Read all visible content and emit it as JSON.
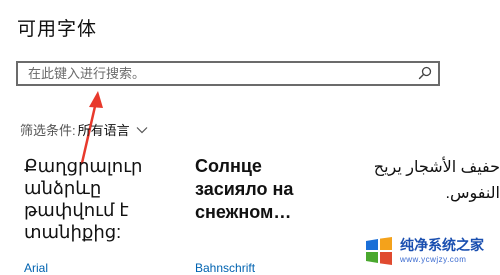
{
  "page": {
    "title": "可用字体"
  },
  "search": {
    "placeholder": "在此键入进行搜索。",
    "value": "",
    "icon": "search-icon"
  },
  "filter": {
    "label": "筛选条件:",
    "value": "所有语言",
    "icon": "chevron-down-icon"
  },
  "fonts": [
    {
      "sample": "Քաղցրալուր անձրևը թափվում է տանիքից:",
      "name": "Arial"
    },
    {
      "sample": "Солнце засияло на снежном…",
      "name": "Bahnschrift"
    },
    {
      "sample": "حفيف الأشجار يريح النفوس.",
      "name": ""
    }
  ],
  "watermark": {
    "title": "纯净系统之家",
    "url": "www.ycwjzy.com",
    "colors": {
      "blue": "#1a6fd8",
      "orange": "#f4a21b",
      "green": "#4aa82e",
      "red": "#e04a2f"
    }
  },
  "annotation": {
    "arrow_color": "#e8392c"
  }
}
